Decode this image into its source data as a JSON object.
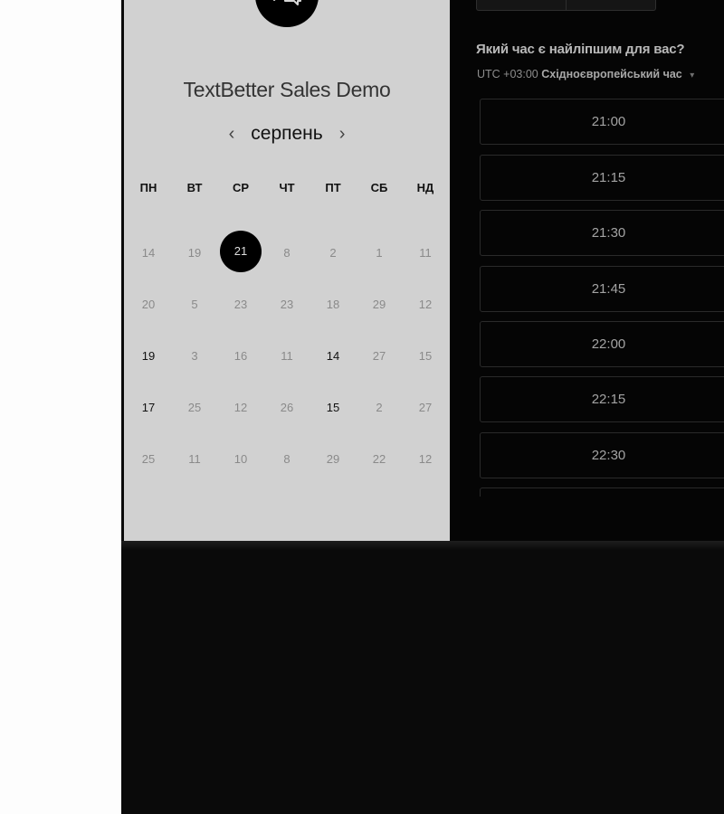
{
  "org": {
    "title": "TextBetter Sales Demo",
    "avatar_icon": "chat-bubbles-icon"
  },
  "calendar": {
    "month": "серпень",
    "prev_icon": "‹",
    "next_icon": "›",
    "weekdays": [
      "ПН",
      "ВТ",
      "СР",
      "ЧТ",
      "ПТ",
      "СБ",
      "НД"
    ],
    "rows": [
      [
        "14",
        "19",
        "21",
        "8",
        "2",
        "1",
        "11"
      ],
      [
        "20",
        "5",
        "23",
        "23",
        "18",
        "29",
        "12"
      ],
      [
        "19",
        "3",
        "16",
        "11",
        "14",
        "27",
        "15"
      ],
      [
        "17",
        "25",
        "12",
        "26",
        "15",
        "2",
        "27"
      ],
      [
        "25",
        "11",
        "10",
        "8",
        "29",
        "22",
        "12"
      ]
    ],
    "selected_day": "21"
  },
  "scheduler": {
    "question": "Який час є найліпшим для вас?",
    "timezone_offset": "UTC +03:00",
    "timezone_name": "Східноєвропейський час",
    "slots": [
      "21:00",
      "21:15",
      "21:30",
      "21:45",
      "22:00",
      "22:15",
      "22:30"
    ]
  },
  "colors": {
    "selected_day_bg": "#000000",
    "calendar_bg": "#d1d1d1",
    "scheduler_bg": "#050505"
  }
}
